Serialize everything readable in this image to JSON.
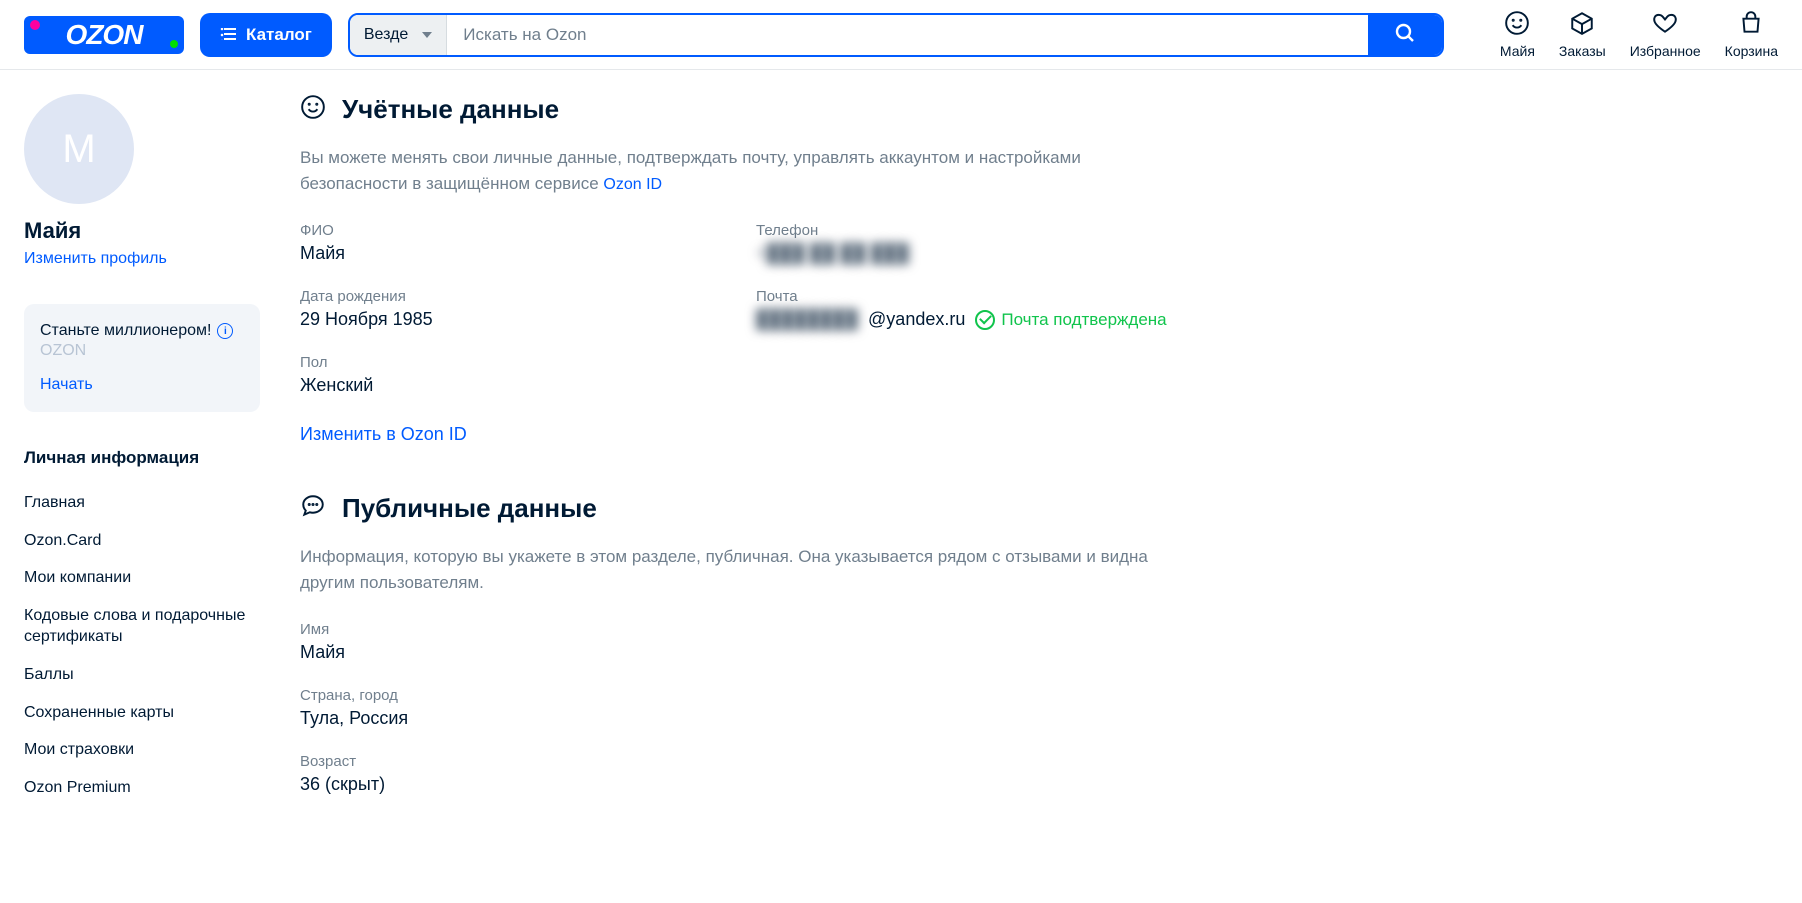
{
  "header": {
    "logo_text": "OZON",
    "catalog_label": "Каталог",
    "search_category_label": "Везде",
    "search_placeholder": "Искать на Ozon",
    "nav": [
      {
        "key": "profile",
        "label": "Майя"
      },
      {
        "key": "orders",
        "label": "Заказы"
      },
      {
        "key": "favorites",
        "label": "Избранное"
      },
      {
        "key": "cart",
        "label": "Корзина"
      }
    ]
  },
  "sidebar": {
    "avatar_initial": "М",
    "name": "Майя",
    "edit_profile_label": "Изменить профиль",
    "promo": {
      "title": "Станьте миллионером!",
      "subtitle": "OZON",
      "cta": "Начать"
    },
    "nav_heading": "Личная информация",
    "nav_items": [
      "Главная",
      "Ozon.Card",
      "Мои компании",
      "Кодовые слова и подарочные сертификаты",
      "Баллы",
      "Сохраненные карты",
      "Мои страховки",
      "Ozon Premium"
    ]
  },
  "account": {
    "title": "Учётные данные",
    "description_prefix": "Вы можете менять свои личные данные, подтверждать почту, управлять аккаунтом и настройками безопасности в защищённом сервисе ",
    "description_link": "Ozon ID",
    "fields": {
      "fio_label": "ФИО",
      "fio_value": "Майя",
      "phone_label": "Телефон",
      "phone_masked": "+███ ██ ██ ███",
      "dob_label": "Дата рождения",
      "dob_value": "29 Ноября 1985",
      "email_label": "Почта",
      "email_masked_part": "████████",
      "email_visible_part": "@yandex.ru",
      "email_verified_label": "Почта подтверждена",
      "gender_label": "Пол",
      "gender_value": "Женский"
    },
    "edit_link": "Изменить в Ozon ID"
  },
  "public": {
    "title": "Публичные данные",
    "description": "Информация, которую вы укажете в этом разделе, публичная. Она указывается рядом с отзывами и видна другим пользователям.",
    "fields": {
      "name_label": "Имя",
      "name_value": "Майя",
      "location_label": "Страна, город",
      "location_value": "Тула, Россия",
      "age_label": "Возраст",
      "age_value": "36 (скрыт)"
    }
  }
}
